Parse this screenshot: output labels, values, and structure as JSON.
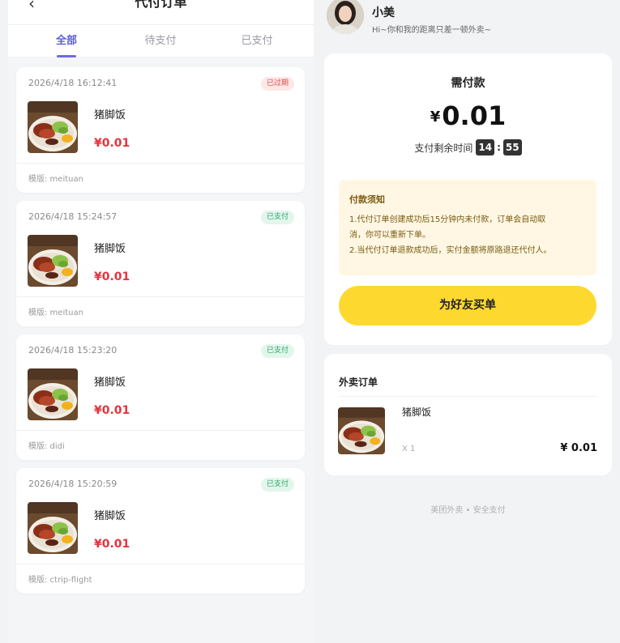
{
  "orders_page": {
    "back_glyph": "‹",
    "title": "代付订单",
    "tabs": [
      {
        "label": "全部"
      },
      {
        "label": "待支付"
      },
      {
        "label": "已支付"
      }
    ],
    "orders": [
      {
        "time": "2026/4/18 16:12:41",
        "status": "已过期",
        "name": "猪脚饭",
        "price": "¥0.01",
        "template": "模版: meituan"
      },
      {
        "time": "2026/4/18 15:24:57",
        "status": "已支付",
        "name": "猪脚饭",
        "price": "¥0.01",
        "template": "模版: meituan"
      },
      {
        "time": "2026/4/18 15:23:20",
        "status": "已支付",
        "name": "猪脚饭",
        "price": "¥0.01",
        "template": "模版: didi"
      },
      {
        "time": "2026/4/18 15:20:59",
        "status": "已支付",
        "name": "猪脚饭",
        "price": "¥0.01",
        "template": "模版: ctrip-flight"
      }
    ]
  },
  "payment_page": {
    "user": {
      "name": "小美",
      "subtitle": "Hi~你和我的距离只差一顿外卖~"
    },
    "pay": {
      "label": "需付款",
      "currency": "¥",
      "amount": "0.01",
      "countdown_label": "支付剩余时间",
      "minutes": "14",
      "seconds": "55"
    },
    "notice": {
      "title": "付款须知",
      "line1": "1.代付订单创建成功后15分钟内未付款，订单会自动取",
      "line2": "消，你可以重新下单。",
      "line3": "2.当代付订单退款成功后，实付金额将原路退还代付人。"
    },
    "buy_button": "为好友买单",
    "waimai": {
      "title": "外卖订单",
      "item_name": "猪脚饭",
      "qty": "X 1",
      "price": "¥ 0.01"
    },
    "footer": "美团外卖 • 安全支付"
  },
  "colors": {
    "accent": "#5b5bd6",
    "price_red": "#e8323c",
    "button_yellow": "#fdd930",
    "notice_bg": "#fff7e3",
    "paid_green": "#2aa86a",
    "expired_red": "#e04848"
  },
  "icons": {
    "back": "chevron-left-icon",
    "food": "food-thumbnail-image",
    "avatar": "user-avatar-image"
  }
}
